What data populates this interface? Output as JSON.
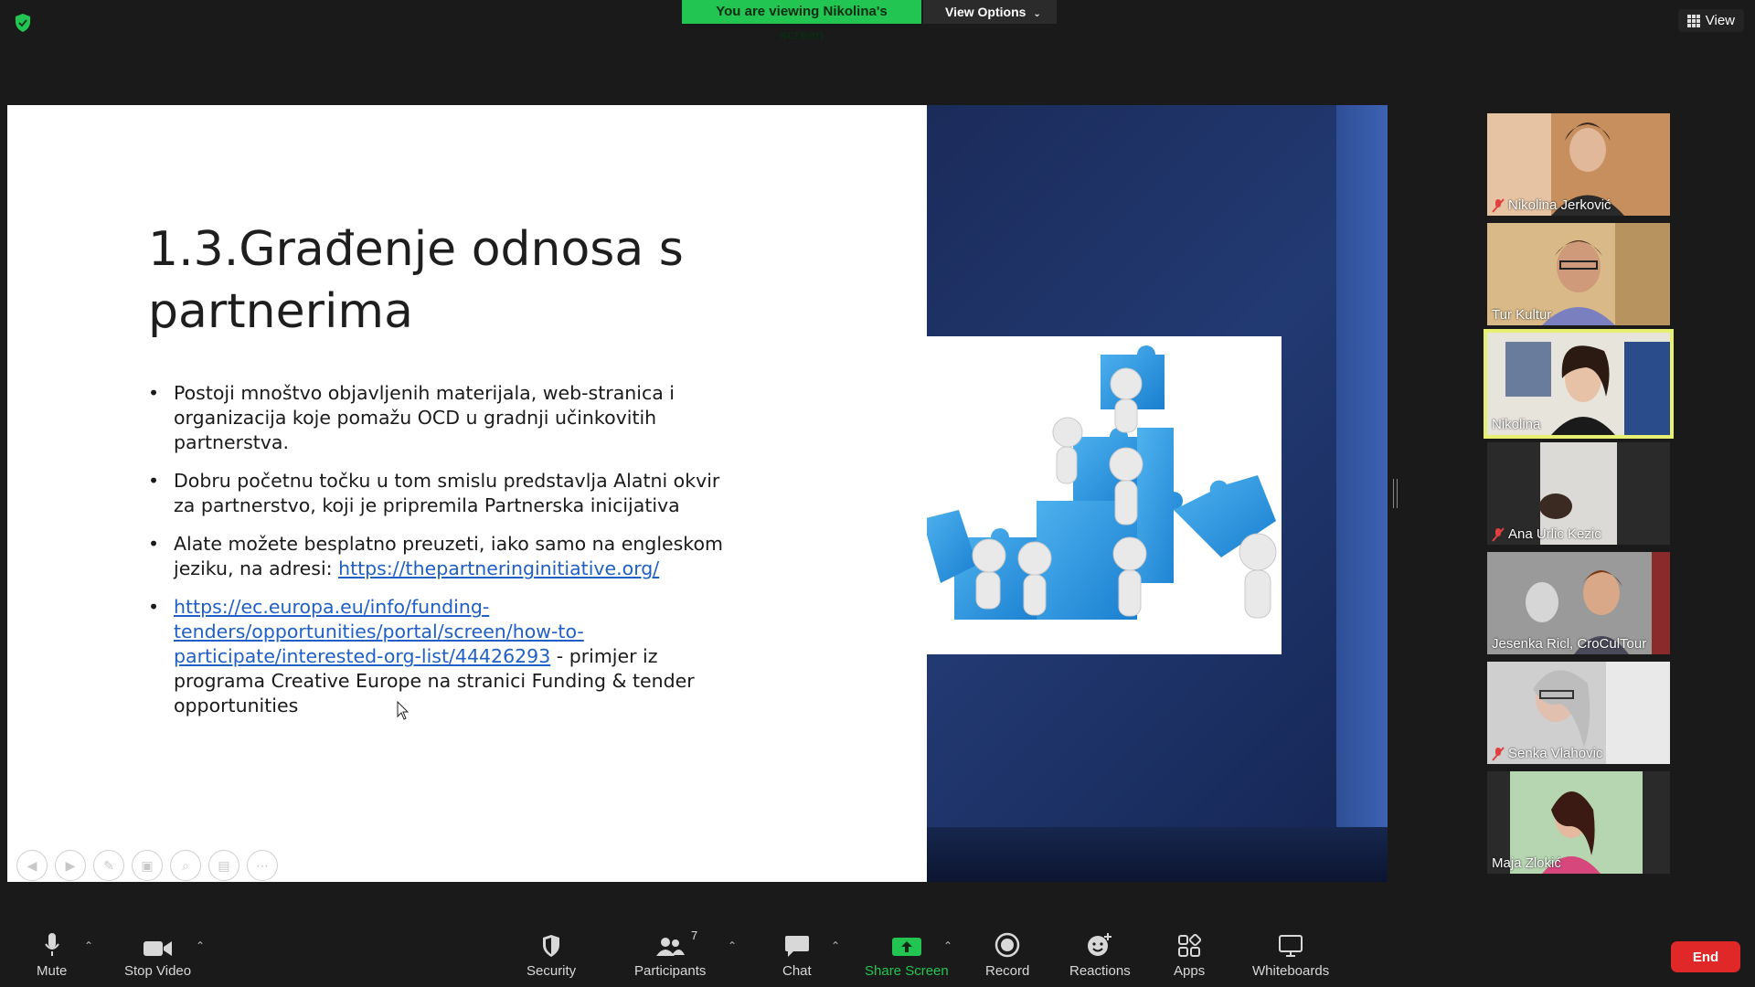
{
  "meeting": {
    "banner": "You are viewing Nikolina's screen",
    "view_options": "View Options",
    "view": "View"
  },
  "slide": {
    "title": "1.3.Građenje odnosa s partnerima",
    "bullet1": "Postoji mnoštvo objavljenih materijala, web-stranica i organizacija koje pomažu OCD u gradnji učinkovitih partnerstva.",
    "bullet2": "Dobru početnu točku u tom smislu predstavlja Alatni okvir za partnerstvo, koji je pripremila Partnerska inicijativa",
    "bullet3_text": "Alate možete besplatno preuzeti, iako samo na engleskom jeziku, na adresi: ",
    "bullet3_link": "https://thepartneringinitiative.org/",
    "bullet4_link": "https://ec.europa.eu/info/funding-tenders/opportunities/portal/screen/how-to-participate/interested-org-list/44426293",
    "bullet4_text": " -  primjer iz programa Creative Europe na stranici Funding & tender opportunities"
  },
  "participants": [
    {
      "name": "Nikolina Jerković",
      "muted": true
    },
    {
      "name": "Tur Kultur",
      "muted": false
    },
    {
      "name": "Nikolina",
      "muted": false,
      "active": true
    },
    {
      "name": "Ana Urlic Kezic",
      "muted": true
    },
    {
      "name": "Jesenka Ricl, CroCulTour",
      "muted": false
    },
    {
      "name": "Senka Vlahovic",
      "muted": true
    },
    {
      "name": "Maja Zlokić",
      "muted": false
    }
  ],
  "toolbar": {
    "mute": "Mute",
    "stop_video": "Stop Video",
    "security": "Security",
    "participants": "Participants",
    "participants_count": "7",
    "chat": "Chat",
    "share_screen": "Share Screen",
    "record": "Record",
    "reactions": "Reactions",
    "apps": "Apps",
    "whiteboards": "Whiteboards",
    "end": "End"
  },
  "colors": {
    "accent_green": "#23c552",
    "end_red": "#e02828",
    "active_speaker": "#e7f070",
    "link_blue": "#1f5fc7"
  }
}
